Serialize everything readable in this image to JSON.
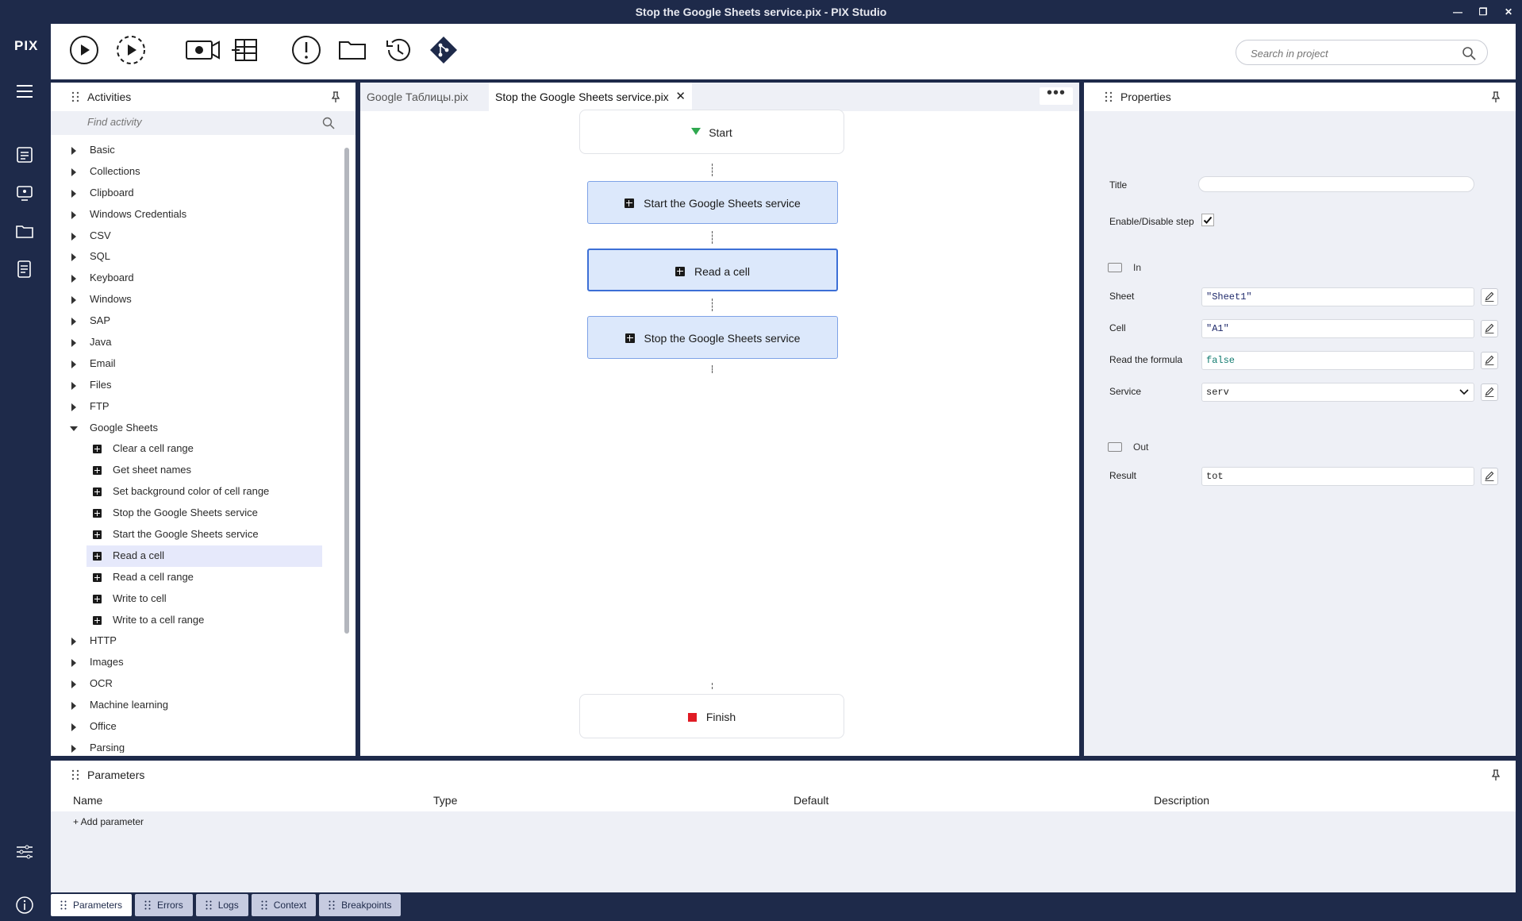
{
  "window": {
    "title": "Stop the Google Sheets service.pix - PIX Studio"
  },
  "leftnav": {
    "logo": "PIX"
  },
  "toolbar": {
    "search_placeholder": "Search in project"
  },
  "activities": {
    "title": "Activities",
    "find_placeholder": "Find activity",
    "categories": [
      {
        "label": "Basic"
      },
      {
        "label": "Collections"
      },
      {
        "label": "Clipboard"
      },
      {
        "label": "Windows Credentials"
      },
      {
        "label": "CSV"
      },
      {
        "label": "SQL"
      },
      {
        "label": "Keyboard"
      },
      {
        "label": "Windows"
      },
      {
        "label": "SAP"
      },
      {
        "label": "Java"
      },
      {
        "label": "Email"
      },
      {
        "label": "Files"
      },
      {
        "label": "FTP"
      },
      {
        "label": "Google Sheets"
      }
    ],
    "google_sheets_items": [
      {
        "label": "Clear a cell range"
      },
      {
        "label": "Get sheet names"
      },
      {
        "label": "Set background color of cell range"
      },
      {
        "label": "Stop the Google Sheets service"
      },
      {
        "label": "Start the Google Sheets service"
      },
      {
        "label": "Read a cell"
      },
      {
        "label": "Read a cell range"
      },
      {
        "label": "Write to cell"
      },
      {
        "label": "Write to a cell range"
      }
    ],
    "categories_after": [
      {
        "label": "HTTP"
      },
      {
        "label": "Images"
      },
      {
        "label": "OCR"
      },
      {
        "label": "Machine learning"
      },
      {
        "label": "Office"
      },
      {
        "label": "Parsing"
      }
    ],
    "selected_item": "Read a cell"
  },
  "editor": {
    "tabs": [
      {
        "label": "Google Таблицы.pix"
      },
      {
        "label": "Stop the Google Sheets service.pix"
      }
    ],
    "active_tab": "Stop the Google Sheets service.pix",
    "close_glyph": "✕",
    "more_glyph": "•••",
    "nodes": {
      "start": "Start",
      "step1": "Start the Google Sheets service",
      "step2": "Read a cell",
      "step3": "Stop the Google Sheets service",
      "finish": "Finish"
    }
  },
  "properties": {
    "title": "Properties",
    "fields": {
      "title_label": "Title",
      "title_value": "",
      "enable_label": "Enable/Disable step",
      "enable_checked": true,
      "in_label": "In",
      "sheet_label": "Sheet",
      "sheet_value": "\"Sheet1\"",
      "cell_label": "Cell",
      "cell_value": "\"A1\"",
      "formula_label": "Read the formula",
      "formula_value": "false",
      "service_label": "Service",
      "service_value": "serv",
      "out_label": "Out",
      "result_label": "Result",
      "result_value": "tot"
    }
  },
  "parameters": {
    "title": "Parameters",
    "columns": [
      "Name",
      "Type",
      "Default",
      "Description"
    ],
    "add_label": "+ Add parameter"
  },
  "bottom_tabs": [
    {
      "label": "Parameters"
    },
    {
      "label": "Errors"
    },
    {
      "label": "Logs"
    },
    {
      "label": "Context"
    },
    {
      "label": "Breakpoints"
    }
  ],
  "colors": {
    "chrome": "#1e2a4a",
    "activity_fill": "#dce8fb",
    "activity_border": "#7ea2e6",
    "start_marker": "#2fa84f",
    "finish_marker": "#e01b24"
  }
}
